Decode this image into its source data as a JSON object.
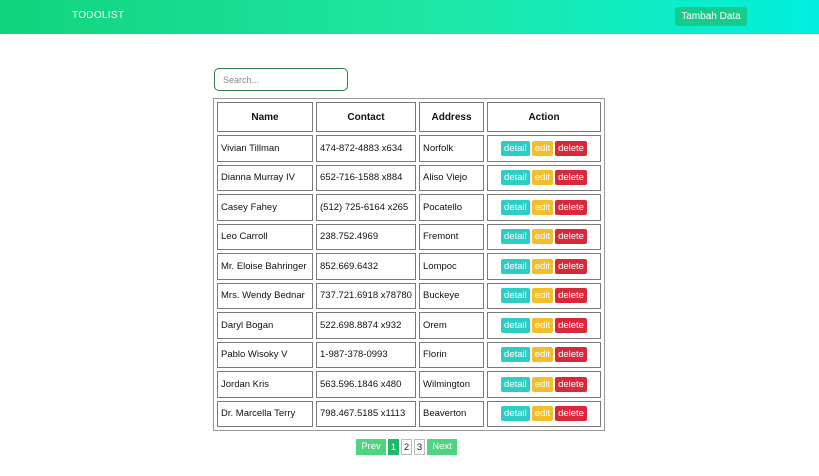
{
  "navbar": {
    "brand": "TODOLIST",
    "add_button": "Tambah Data"
  },
  "search": {
    "placeholder": "Search..."
  },
  "table": {
    "headers": [
      "Name",
      "Contact",
      "Address",
      "Action"
    ],
    "rows": [
      {
        "name": "Vivian Tillman",
        "contact": "474-872-4883 x634",
        "address": "Norfolk"
      },
      {
        "name": "Dianna Murray IV",
        "contact": "652-716-1588 x884",
        "address": "Aliso Viejo"
      },
      {
        "name": "Casey Fahey",
        "contact": "(512) 725-6164 x265",
        "address": "Pocatello"
      },
      {
        "name": "Leo Carroll",
        "contact": "238.752.4969",
        "address": "Fremont"
      },
      {
        "name": "Mr. Eloise Bahringer",
        "contact": "852.669.6432",
        "address": "Lompoc"
      },
      {
        "name": "Mrs. Wendy Bednar",
        "contact": "737.721.6918 x78780",
        "address": "Buckeye"
      },
      {
        "name": "Daryl Bogan",
        "contact": "522.698.8874 x932",
        "address": "Orem"
      },
      {
        "name": "Pablo Wisoky V",
        "contact": "1-987-378-0993",
        "address": "Florin"
      },
      {
        "name": "Jordan Kris",
        "contact": "563.596.1846 x480",
        "address": "Wilmington"
      },
      {
        "name": "Dr. Marcella Terry",
        "contact": "798.467.5185 x1113",
        "address": "Beaverton"
      }
    ],
    "actions": {
      "detail": "detail",
      "edit": "edit",
      "delete": "delete"
    }
  },
  "pagination": {
    "prev": "Prev",
    "pages": [
      "1",
      "2",
      "3"
    ],
    "active_page": "1",
    "next": "Next"
  },
  "colors": {
    "navbar_start": "#12d37d",
    "navbar_end": "#00f0df",
    "detail": "#2ecdc4",
    "edit": "#f4bd2a",
    "delete": "#d9283a",
    "pager": "#4ed580"
  }
}
